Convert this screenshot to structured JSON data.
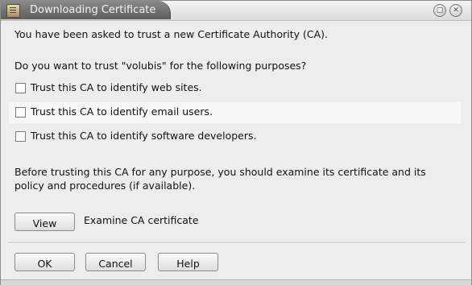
{
  "window": {
    "title": "Downloading Certificate",
    "controls": [
      "maximize-icon",
      "close-icon"
    ]
  },
  "dialog": {
    "intro": "You have been asked to trust a new Certificate Authority (CA).",
    "question": "Do you want to trust \"volubis\" for the following purposes?",
    "options": [
      {
        "label": "Trust this CA to identify web sites.",
        "checked": false
      },
      {
        "label": "Trust this CA to identify email users.",
        "checked": false
      },
      {
        "label": "Trust this CA to identify software developers.",
        "checked": false
      }
    ],
    "advice_line1": "Before trusting this CA for any purpose, you should examine its certificate and its",
    "advice_line2": "policy and procedures (if available).",
    "view_label": "View",
    "examine_label": "Examine CA certificate"
  },
  "buttons": {
    "ok": "OK",
    "cancel": "Cancel",
    "help": "Help"
  }
}
